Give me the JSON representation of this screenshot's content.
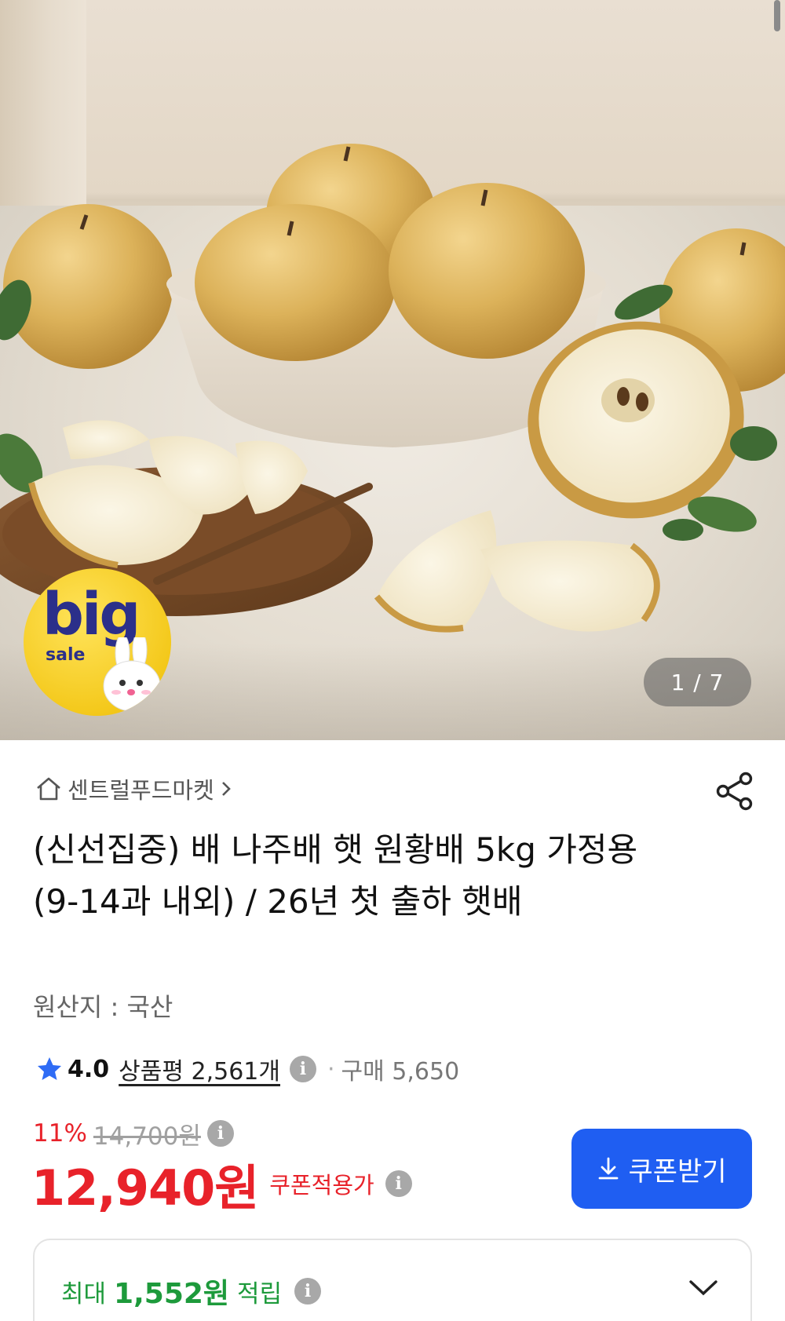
{
  "gallery": {
    "counter": "1 / 7",
    "badge": {
      "big": "big",
      "sale": "sale"
    }
  },
  "store": {
    "name": "센트럴푸드마켓"
  },
  "product": {
    "title": "(신선집중) 배 나주배 햇 원황배 5kg 가정용 (9-14과 내외) / 26년 첫 출하 햇배",
    "origin": "원산지 : 국산"
  },
  "rating": {
    "score": "4.0",
    "review_label": "상품평 2,561개",
    "purchase": "구매 5,650"
  },
  "pricing": {
    "discount_rate": "11%",
    "original_price": "14,700원",
    "price": "12,940원",
    "coupon_label": "쿠폰적용가",
    "coupon_button": "쿠폰받기"
  },
  "points": {
    "prefix": "최대",
    "amount": "1,552원",
    "suffix": "적립"
  },
  "colors": {
    "accent_red": "#e8222a",
    "accent_blue": "#1f5ef2",
    "star_blue": "#2f6cf5",
    "points_green": "#1d9a3b"
  },
  "icons": [
    "home-icon",
    "chevron-right-icon",
    "share-icon",
    "star-icon",
    "info-icon",
    "download-icon",
    "chevron-down-icon"
  ]
}
